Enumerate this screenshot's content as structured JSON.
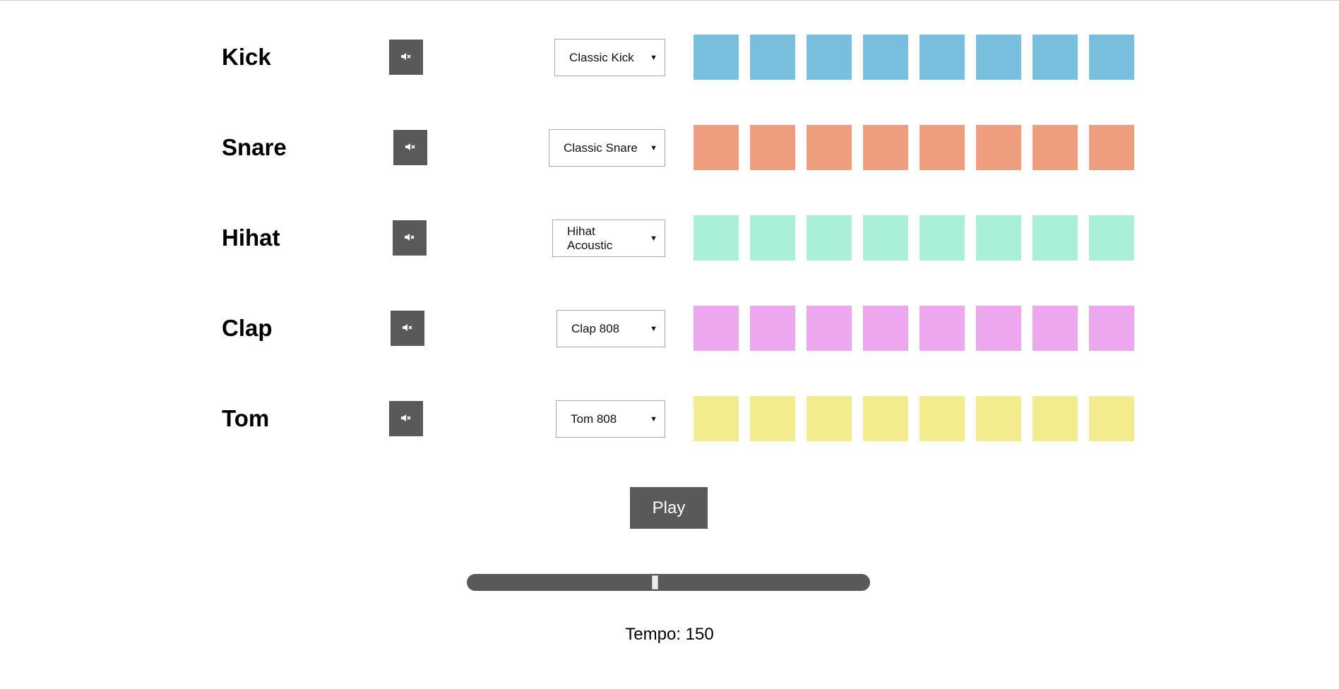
{
  "tracks": [
    {
      "name": "Kick",
      "sample": "Classic Kick",
      "color": "#78bfdf",
      "muted_icon": "volume-mute-icon",
      "steps": 8
    },
    {
      "name": "Snare",
      "sample": "Classic Snare",
      "color": "#ee9d7f",
      "muted_icon": "volume-mute-icon",
      "steps": 8
    },
    {
      "name": "Hihat",
      "sample": "Hihat Acoustic",
      "color": "#aaf0d8",
      "muted_icon": "volume-mute-icon",
      "steps": 8
    },
    {
      "name": "Clap",
      "sample": "Clap 808",
      "color": "#eca7ee",
      "muted_icon": "volume-mute-icon",
      "steps": 8
    },
    {
      "name": "Tom",
      "sample": "Tom 808",
      "color": "#f2ec8f",
      "muted_icon": "volume-mute-icon",
      "steps": 8
    }
  ],
  "controls": {
    "play_label": "Play",
    "tempo_text": "Tempo: 150",
    "tempo_value": 150,
    "tempo_slider_fraction": 0.466,
    "button_color": "#5a5859"
  }
}
